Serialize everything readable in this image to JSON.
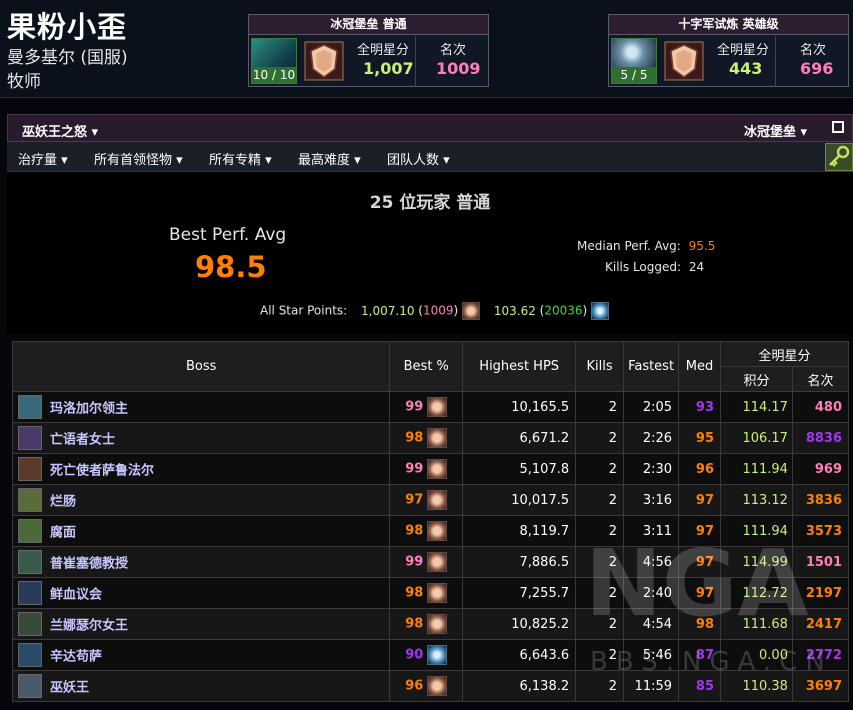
{
  "character": {
    "name": "果粉小歪",
    "server": "曼多基尔 (国服)",
    "class": "牧师"
  },
  "zones": [
    {
      "title": "冰冠堡垒 普通",
      "progress": "10 / 10",
      "points_label": "全明星分",
      "points": "1,007",
      "rank_label": "名次",
      "rank": "1009"
    },
    {
      "title": "十字军试炼 英雄级",
      "progress": "5 / 5",
      "points_label": "全明星分",
      "points": "443",
      "rank_label": "名次",
      "rank": "696"
    }
  ],
  "nav": {
    "expansion": "巫妖王之怒",
    "zone": "冰冠堡垒"
  },
  "filters": [
    "治疗量",
    "所有首领怪物",
    "所有专精",
    "最高难度",
    "团队人数"
  ],
  "summary": {
    "title": "25 位玩家 普通",
    "best_perf_label": "Best Perf. Avg",
    "best_perf_value": "98.5",
    "median_label": "Median Perf. Avg:",
    "median_value": "95.5",
    "kills_label": "Kills Logged:",
    "kills_value": "24",
    "star_label": "All Star Points:",
    "star_points_1": "1,007.10",
    "star_rank_1": "1009",
    "star_points_2": "103.62",
    "star_rank_2": "20036"
  },
  "table": {
    "headers": {
      "boss": "Boss",
      "best": "Best %",
      "hps": "Highest HPS",
      "kills": "Kills",
      "fastest": "Fastest",
      "med": "Med",
      "allstar": "全明星分",
      "points": "积分",
      "rank": "名次"
    },
    "rows": [
      {
        "boss": "玛洛加尔领主",
        "best": "99",
        "best_color": "pink",
        "hps": "10,165.5",
        "kills": "2",
        "fastest": "2:05",
        "med": "93",
        "med_color": "purple",
        "points": "114.17",
        "rank": "480",
        "rank_color": "pink",
        "icon": "#3a6a7a"
      },
      {
        "boss": "亡语者女士",
        "best": "98",
        "best_color": "orange",
        "hps": "6,671.2",
        "kills": "2",
        "fastest": "2:26",
        "med": "95",
        "med_color": "orange",
        "points": "106.17",
        "rank": "8836",
        "rank_color": "purple",
        "icon": "#4a3a6a"
      },
      {
        "boss": "死亡使者萨鲁法尔",
        "best": "99",
        "best_color": "pink",
        "hps": "5,107.8",
        "kills": "2",
        "fastest": "2:30",
        "med": "96",
        "med_color": "orange",
        "points": "111.94",
        "rank": "969",
        "rank_color": "pink",
        "icon": "#5a3a2a"
      },
      {
        "boss": "烂肠",
        "best": "97",
        "best_color": "orange",
        "hps": "10,017.5",
        "kills": "2",
        "fastest": "3:16",
        "med": "97",
        "med_color": "orange",
        "points": "113.12",
        "rank": "3836",
        "rank_color": "orange",
        "icon": "#5a6a3a"
      },
      {
        "boss": "腐面",
        "best": "98",
        "best_color": "orange",
        "hps": "8,119.7",
        "kills": "2",
        "fastest": "3:11",
        "med": "97",
        "med_color": "orange",
        "points": "111.94",
        "rank": "3573",
        "rank_color": "orange",
        "icon": "#4a6a3a"
      },
      {
        "boss": "普崔塞德教授",
        "best": "99",
        "best_color": "pink",
        "hps": "7,886.5",
        "kills": "2",
        "fastest": "4:56",
        "med": "97",
        "med_color": "orange",
        "points": "114.99",
        "rank": "1501",
        "rank_color": "pink",
        "icon": "#3a5a4a"
      },
      {
        "boss": "鲜血议会",
        "best": "98",
        "best_color": "orange",
        "hps": "7,255.7",
        "kills": "2",
        "fastest": "2:40",
        "med": "97",
        "med_color": "orange",
        "points": "112.72",
        "rank": "2197",
        "rank_color": "orange",
        "icon": "#2a3a5a"
      },
      {
        "boss": "兰娜瑟尔女王",
        "best": "98",
        "best_color": "orange",
        "hps": "10,825.2",
        "kills": "2",
        "fastest": "4:54",
        "med": "98",
        "med_color": "orange",
        "points": "111.68",
        "rank": "2417",
        "rank_color": "orange",
        "icon": "#3a4a3a"
      },
      {
        "boss": "辛达苟萨",
        "best": "90",
        "best_color": "purple",
        "hps": "6,643.6",
        "kills": "2",
        "fastest": "5:46",
        "med": "87",
        "med_color": "purple",
        "points": "0.00",
        "rank": "2772",
        "rank_color": "purple",
        "icon": "#2a4a6a",
        "blue_icon": true
      },
      {
        "boss": "巫妖王",
        "best": "96",
        "best_color": "orange",
        "hps": "6,138.2",
        "kills": "2",
        "fastest": "11:59",
        "med": "85",
        "med_color": "purple",
        "points": "110.38",
        "rank": "3697",
        "rank_color": "orange",
        "icon": "#4a5a6a"
      }
    ]
  },
  "watermark": {
    "logo": "NGA",
    "site": "BBS.NGA.CN"
  }
}
